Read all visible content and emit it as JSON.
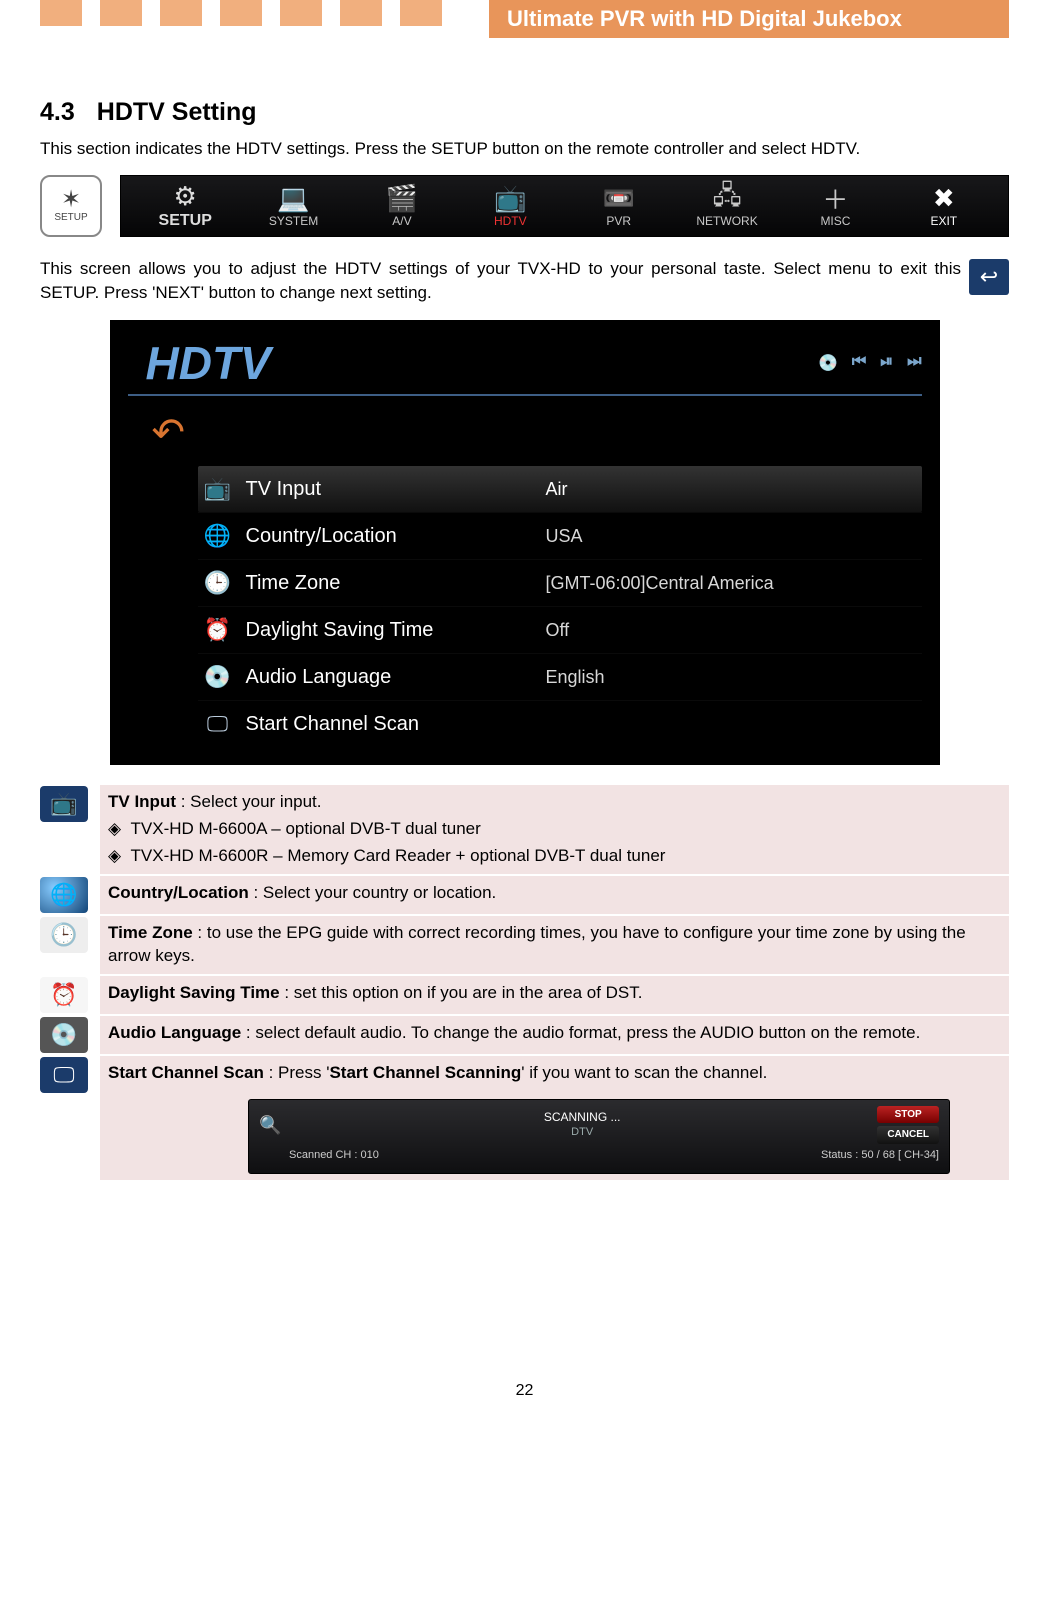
{
  "header": {
    "title": "Ultimate PVR with HD Digital Jukebox"
  },
  "topbar_colors": [
    "#f1af7e",
    "#f1af7e",
    "#f1af7e",
    "#f1af7e",
    "#f1af7e",
    "#f1af7e",
    "#f1af7e"
  ],
  "section": {
    "number": "4.3",
    "title": "HDTV Setting",
    "intro": "This section indicates the HDTV settings. Press the SETUP button on the remote controller and select HDTV."
  },
  "setup_button_label": "SETUP",
  "toolbar": [
    {
      "icon": "⚙",
      "label": "SETUP",
      "cls": "setup-item"
    },
    {
      "icon": "💻",
      "label": "SYSTEM"
    },
    {
      "icon": "🎬",
      "label": "A/V"
    },
    {
      "icon": "📺",
      "label": "HDTV",
      "cls": "active"
    },
    {
      "icon": "📼",
      "label": "PVR"
    },
    {
      "icon": "🖧",
      "label": "NETWORK"
    },
    {
      "icon": "＋",
      "label": "MISC"
    },
    {
      "icon": "✖",
      "label": "EXIT",
      "cls": "exit"
    }
  ],
  "para2": "This screen allows you to adjust the HDTV settings of your TVX-HD to your personal taste. Select           menu to exit this SETUP. Press 'NEXT' button to change next setting.",
  "hdtv_panel": {
    "title": "HDTV",
    "ctl_icons": [
      "💿",
      "⏮",
      "⏯",
      "⏭"
    ],
    "rows": [
      {
        "icon": "📺",
        "label": "TV Input",
        "value": "Air",
        "highlight": true
      },
      {
        "icon": "🌐",
        "label": "Country/Location",
        "value": "USA"
      },
      {
        "icon": "🕒",
        "label": "Time Zone",
        "value": "[GMT-06:00]Central America"
      },
      {
        "icon": "⏰",
        "label": "Daylight Saving Time",
        "value": "Off"
      },
      {
        "icon": "💿",
        "label": "Audio Language",
        "value": "English"
      },
      {
        "icon": "🖵",
        "label": "Start Channel Scan",
        "value": ""
      }
    ]
  },
  "descriptions": [
    {
      "icon": "tv",
      "glyph": "📺",
      "title": "TV Input",
      "text": " : Select your input.",
      "bullets": [
        "TVX-HD M-6600A – optional DVB-T dual tuner",
        "TVX-HD M-6600R – Memory Card Reader + optional DVB-T dual tuner"
      ]
    },
    {
      "icon": "globe",
      "glyph": "🌐",
      "title": "Country/Location",
      "text": " : Select your country or location."
    },
    {
      "icon": "clock",
      "glyph": "🕒",
      "title": "Time Zone",
      "text": " : to use the EPG guide with correct recording times, you have to configure your time zone by using the arrow keys."
    },
    {
      "icon": "alarm",
      "glyph": "⏰",
      "title": "Daylight Saving Time",
      "text": " : set this option on if you are in the area of DST."
    },
    {
      "icon": "disc",
      "glyph": "💿",
      "title": "Audio Language",
      "text": " : select default audio. To change the audio format, press the AUDIO button on the remote."
    },
    {
      "icon": "tv",
      "glyph": "🖵",
      "title": "Start Channel Scan",
      "text_pre": " : Press '",
      "text_bold": "Start Channel Scanning",
      "text_post": "' if you want to scan the channel."
    }
  ],
  "scan": {
    "title": "SCANNING ...",
    "subtitle": "DTV",
    "scanned": "Scanned CH : 010",
    "status": "Status : 50 / 68 [ CH-34]",
    "stop": "STOP",
    "cancel": "CANCEL"
  },
  "page_number": "22"
}
